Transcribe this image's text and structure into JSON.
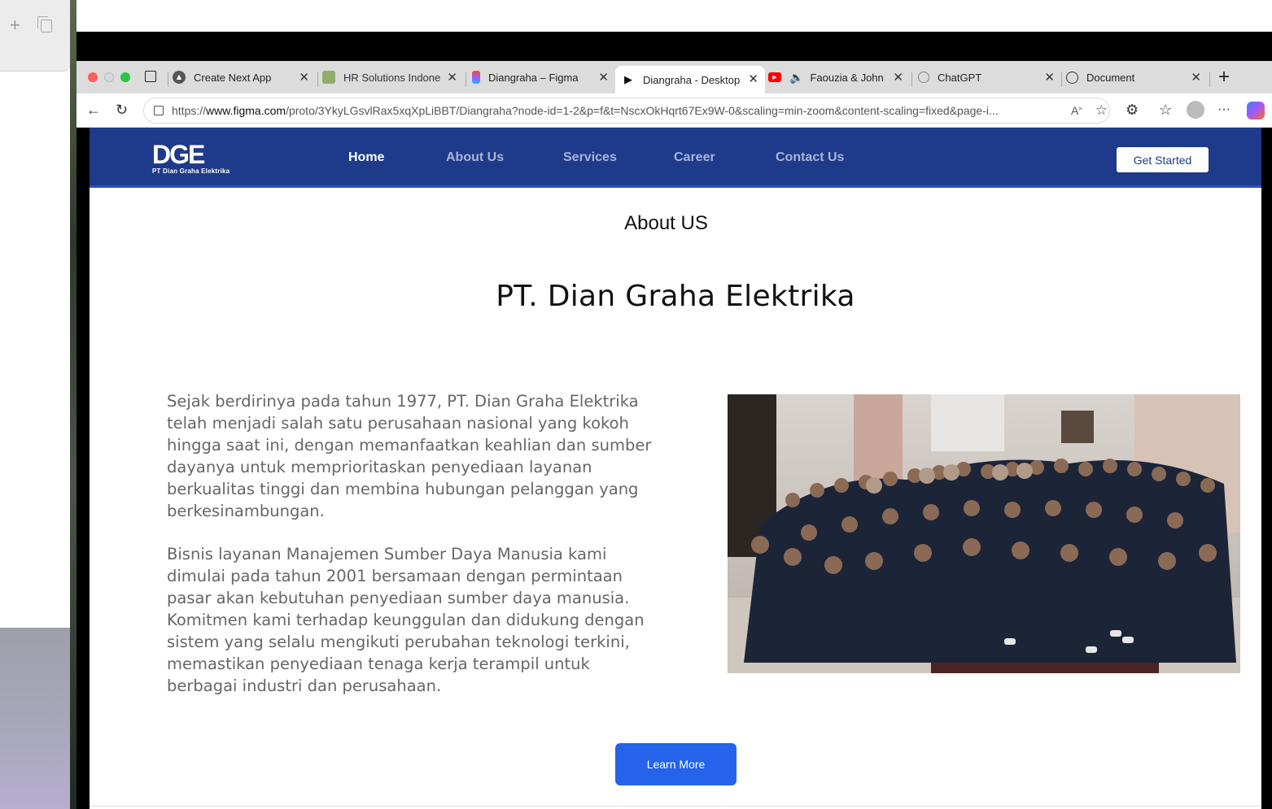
{
  "tabs": [
    {
      "title": "Create Next App",
      "icon": "vercel-icon"
    },
    {
      "title": "HR Solutions Indonesia",
      "icon": "hr-icon"
    },
    {
      "title": "Diangraha – Figma",
      "icon": "figma-icon"
    },
    {
      "title": "Diangraha - Desktop",
      "icon": "play-icon",
      "active": true
    },
    {
      "title": "Faouzia & John Legend",
      "icon": "youtube-icon"
    },
    {
      "title": "ChatGPT",
      "icon": "chatgpt-icon"
    },
    {
      "title": "Document",
      "icon": "globe-icon"
    }
  ],
  "address_bar": {
    "prefix": "https://",
    "domain": "www.figma.com",
    "path": "/proto/3YkyLGsvlRax5xqXpLiBBT/Diangraha?node-id=1-2&p=f&t=NscxOkHqrt67Ex9W-0&scaling=min-zoom&content-scaling=fixed&page-i..."
  },
  "site": {
    "logo_mark": "DGE",
    "logo_subtitle": "PT Dian Graha Elektrika",
    "nav": [
      "Home",
      "About Us",
      "Services",
      "Career",
      "Contact Us"
    ],
    "cta": "Get Started"
  },
  "content": {
    "section_heading": "About US",
    "company_name": "PT. Dian Graha Elektrika",
    "paragraph1": "Sejak berdirinya pada tahun 1977, PT. Dian Graha Elektrika telah menjadi salah satu perusahaan nasional yang kokoh hingga saat ini, dengan memanfaatkan keahlian dan sumber dayanya untuk memprioritaskan penyediaan layanan berkualitas tinggi dan membina hubungan pelanggan yang berkesinambungan.",
    "paragraph2": "Bisnis layanan Manajemen Sumber Daya Manusia kami dimulai pada tahun 2001 bersamaan dengan permintaan pasar akan kebutuhan penyediaan sumber daya manusia. Komitmen kami terhadap keunggulan dan didukung dengan sistem yang selalu mengikuti perubahan teknologi terkini, memastikan penyediaan tenaga kerja terampil untuk berbagai industri dan perusahaan.",
    "button": "Learn More"
  },
  "colors": {
    "nav_bg": "#1e3a8a",
    "button_bg": "#2563eb"
  }
}
